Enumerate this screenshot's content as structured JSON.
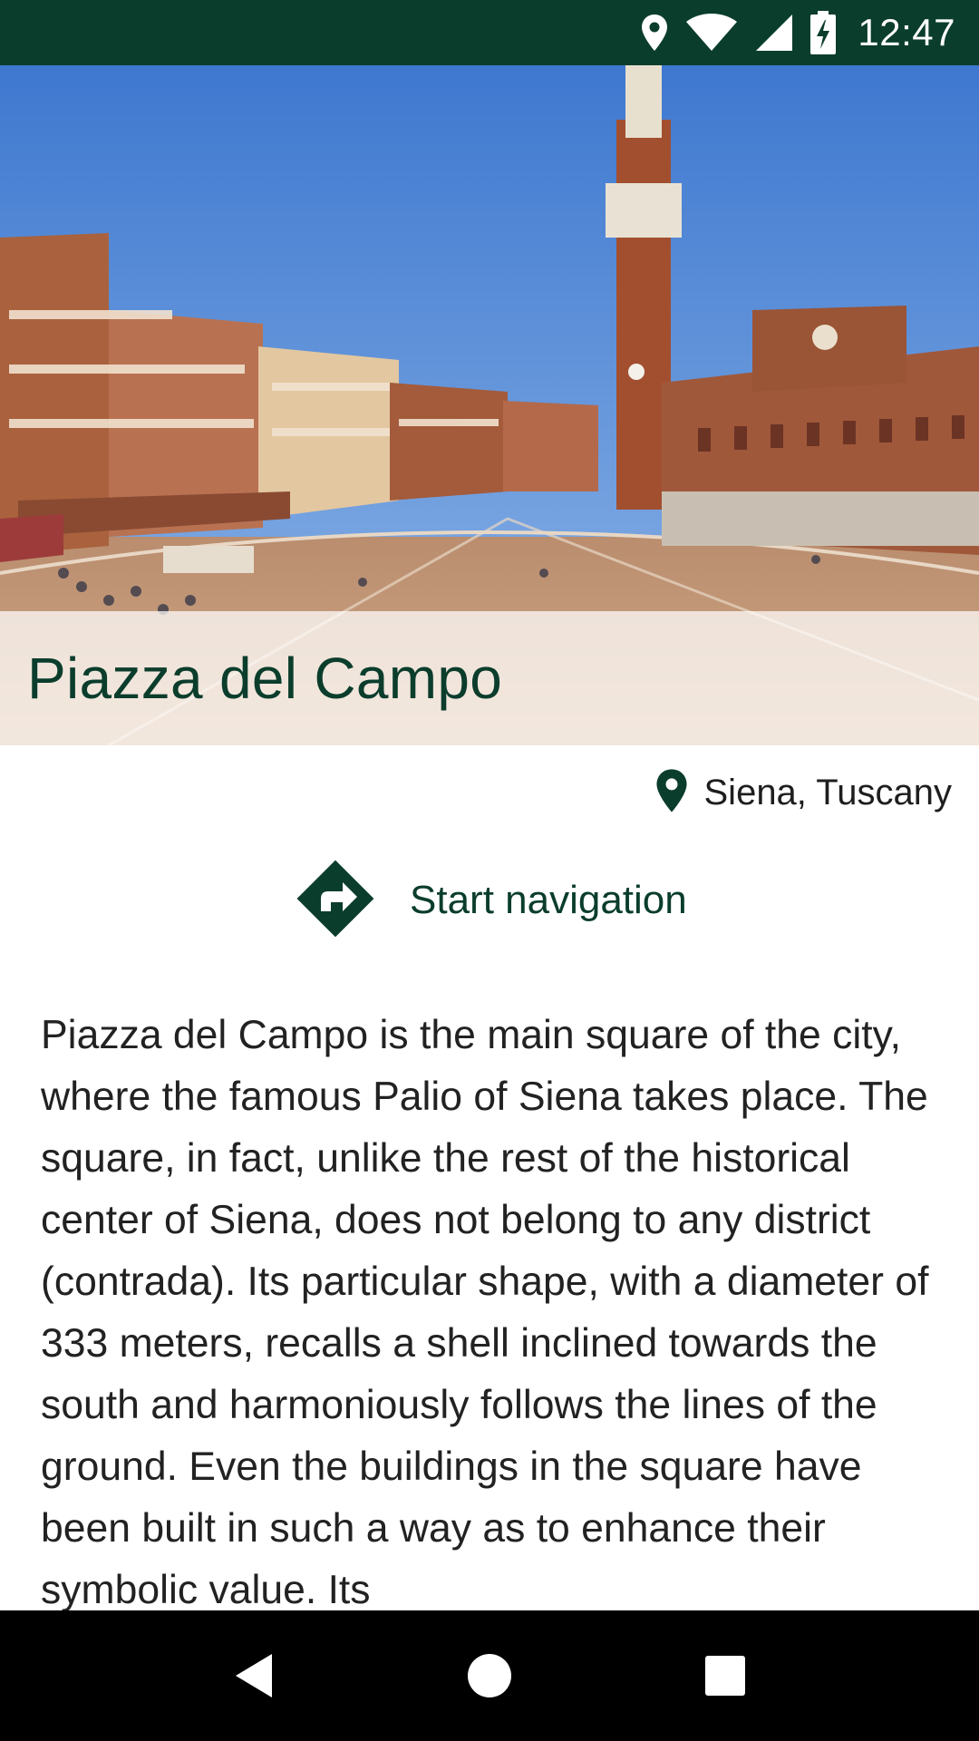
{
  "status_bar": {
    "time": "12:47",
    "icons": [
      "location-pin-icon",
      "wifi-icon",
      "signal-icon",
      "battery-charging-icon"
    ]
  },
  "hero": {
    "title": "Piazza del Campo",
    "image_subject": "panoramic photo of Piazza del Campo with Torre del Mangia"
  },
  "location": {
    "icon": "location-pin-icon",
    "text": "Siena, Tuscany"
  },
  "navigation": {
    "icon": "directions-icon",
    "label": "Start navigation"
  },
  "description": {
    "text": "Piazza del Campo is the main square of the city, where the famous Palio of Siena takes place. The square, in fact, unlike the rest of the historical center of Siena, does not belong to any district (contrada). Its particular shape, with a diameter of 333 meters, recalls a shell inclined towards the south and harmoniously follows the lines of the ground. Even the buildings in the square have been built in such a way as to enhance their symbolic value. Its"
  },
  "system_nav": {
    "buttons": [
      "back-icon",
      "home-icon",
      "recents-icon"
    ]
  },
  "colors": {
    "primary_dark": "#0b3d2c",
    "text": "#222222",
    "sky": "#5b8fd6",
    "brick": "#a0583a",
    "piazza": "#c9a07e"
  }
}
